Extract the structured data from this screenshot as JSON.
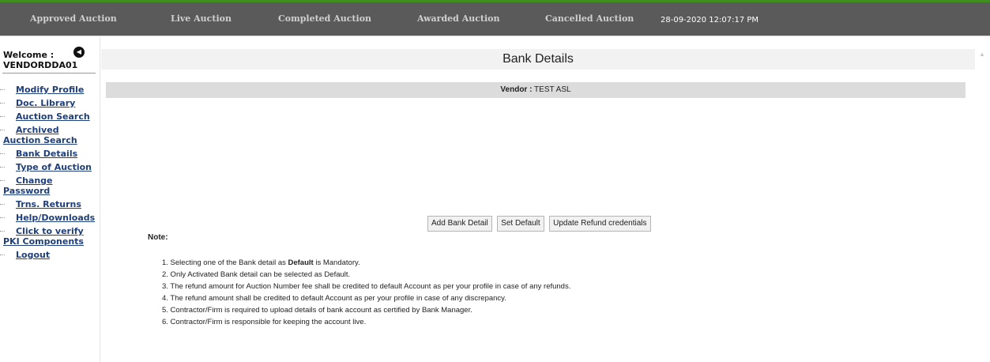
{
  "nav": {
    "items": [
      "Approved Auction",
      "Live Auction",
      "Completed Auction",
      "Awarded Auction",
      "Cancelled Auction"
    ],
    "datetime": "28-09-2020 12:07:17 PM"
  },
  "sidebar": {
    "welcome_label": "Welcome :",
    "username": "VENDORDDA01",
    "collapse_icon": "collapse-arrow-icon",
    "items": [
      {
        "line1": "Modify Profile"
      },
      {
        "line1": "Doc. Library"
      },
      {
        "line1": "Auction Search"
      },
      {
        "line1": "Archived",
        "line2": "Auction Search"
      },
      {
        "line1": "Bank Details"
      },
      {
        "line1": "Type of Auction"
      },
      {
        "line1": "Change",
        "line2": "Password"
      },
      {
        "line1": "Trns. Returns"
      },
      {
        "line1": "Help/Downloads"
      },
      {
        "line1": "Click to verify",
        "line2": "PKI Components"
      },
      {
        "line1": "Logout"
      }
    ]
  },
  "main": {
    "title": "Bank Details",
    "vendor_label": "Vendor :",
    "vendor_value": "TEST ASL",
    "buttons": {
      "add": "Add Bank Detail",
      "set_default": "Set Default",
      "update_refund": "Update Refund credentials"
    },
    "note_label": "Note:",
    "notes": {
      "n1_pre": "1. Selecting one of the Bank detail as ",
      "n1_bold": "Default",
      "n1_post": " is Mandatory.",
      "n2": "2. Only Activated Bank detail can be selected as Default.",
      "n3": "3. The refund amount for Auction Number fee shall be credited to default Account as per your profile in case of any refunds.",
      "n4": "4. The refund amount shall be credited to default Account as per your profile in case of any discrepancy.",
      "n5": "5. Contractor/Firm is required to upload details of bank account as certified by Bank Manager.",
      "n6": "6. Contractor/Firm is responsible for keeping the account live."
    }
  },
  "colors": {
    "nav_bg": "#5a5a5a",
    "accent_green": "#3f8f1f",
    "link_blue": "#1f3f7a",
    "vendor_bar": "#dcdcdc"
  }
}
